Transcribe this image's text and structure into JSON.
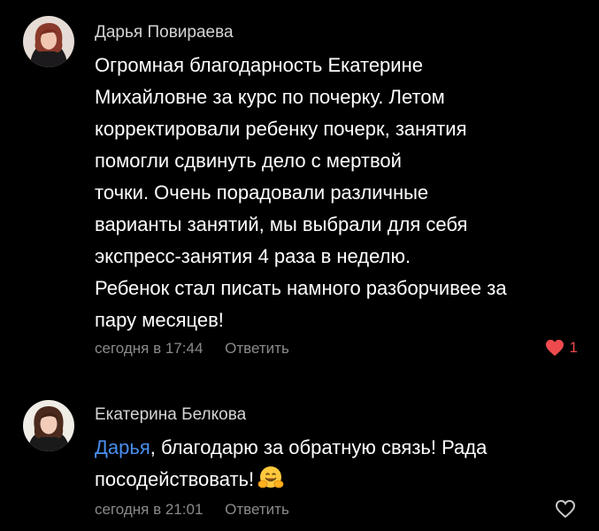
{
  "comments": [
    {
      "author": "Дарья Повираева",
      "lines": [
        "Огромная благодарность Екатерине",
        "Михайловне за курс по почерку. Летом",
        "корректировали ребенку почерк, занятия",
        "помогли сдвинуть дело с мертвой",
        "точки. Очень порадовали различные",
        "варианты занятий, мы выбрали для себя",
        "экспресс-занятия 4 раза в неделю.",
        "Ребенок стал писать намного разборчивее за",
        "пару месяцев!"
      ],
      "time": "сегодня в 17:44",
      "reply_label": "Ответить",
      "likes": "1",
      "liked": true,
      "like_icon": "heart-filled-icon",
      "like_color": "#ef4b4f"
    },
    {
      "author": "Екатерина Белкова",
      "mention": "Дарья",
      "line1_rest": ", благодарю за обратную связь! Рада",
      "line2": "посодействовать!",
      "emoji": "hugging-face-emoji",
      "time": "сегодня в 21:01",
      "reply_label": "Ответить",
      "liked": false,
      "like_icon": "heart-outline-icon"
    }
  ],
  "colors": {
    "background": "#000000",
    "author": "#d4d4d4",
    "meta": "#8a8a8a",
    "mention": "#4a8ff0",
    "like": "#ef4b4f"
  }
}
